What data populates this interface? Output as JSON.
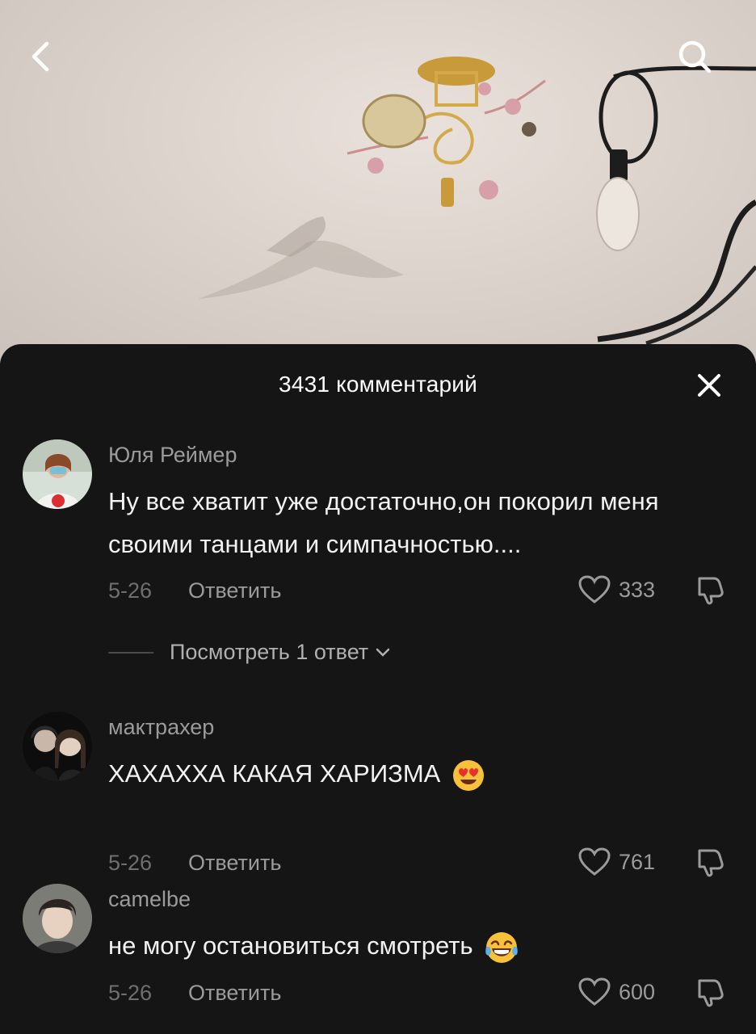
{
  "header": {
    "back_icon": "chevron-left-icon",
    "search_icon": "search-icon"
  },
  "comments_sheet": {
    "title": "3431 комментарий",
    "close_icon": "close-icon",
    "comments": [
      {
        "username": "Юля Реймер",
        "text": "Ну все хватит уже достаточно,он покорил меня своими танцами и симпачностью....",
        "date": "5-26",
        "reply_label": "Ответить",
        "likes": "333",
        "view_replies_label": "Посмотреть 1 ответ"
      },
      {
        "username": "мактрахер",
        "text": "ХАХАХХА КАКАЯ ХАРИЗМА",
        "emoji": "heart-eyes-emoji",
        "date": "5-26",
        "reply_label": "Ответить",
        "likes": "761"
      },
      {
        "username": "camelbe",
        "text": "не могу остановиться смотреть",
        "emoji": "tears-of-joy-emoji",
        "date": "5-26",
        "reply_label": "Ответить",
        "likes": "600"
      }
    ]
  },
  "colors": {
    "sheet_bg": "#151515",
    "text_primary": "#f2f2f2",
    "text_secondary": "#9b9b9b",
    "text_muted": "#6f6f6f"
  }
}
